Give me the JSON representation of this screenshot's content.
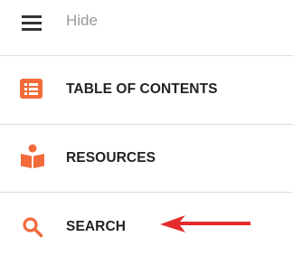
{
  "colors": {
    "accent": "#f26b3a",
    "arrow": "#e52b2b",
    "text": "#222222",
    "muted": "#9a9a9a",
    "divider": "#dcdcdc"
  },
  "hide_toggle": {
    "label": "Hide",
    "icon": "hamburger-menu-icon"
  },
  "nav": {
    "items": [
      {
        "label": "TABLE OF CONTENTS",
        "icon": "list-icon"
      },
      {
        "label": "RESOURCES",
        "icon": "book-reader-icon"
      },
      {
        "label": "SEARCH",
        "icon": "search-icon"
      }
    ]
  },
  "annotation": {
    "icon": "red-arrow-icon"
  }
}
